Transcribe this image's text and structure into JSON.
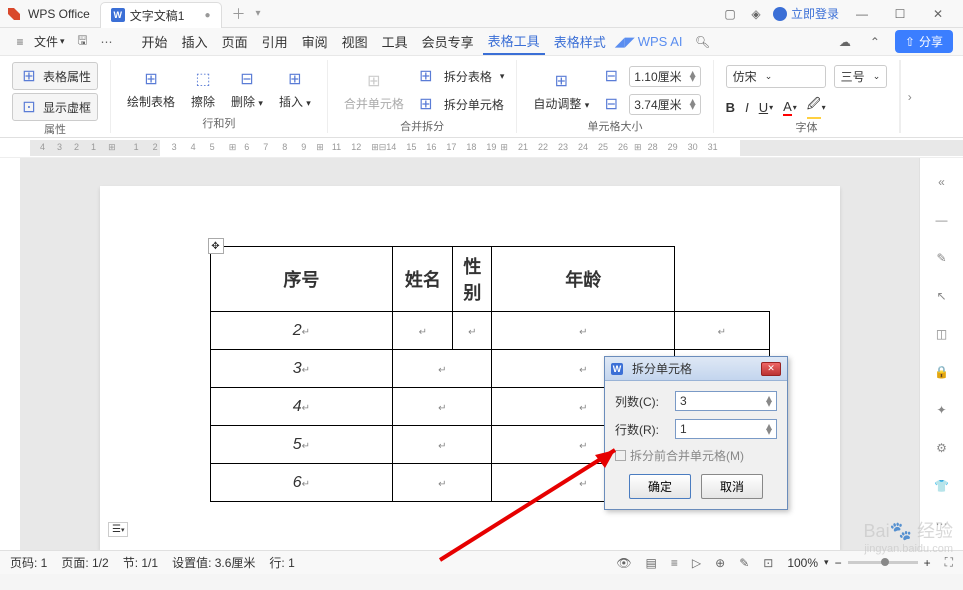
{
  "title_bar": {
    "app_name": "WPS Office",
    "tab_label": "文字文稿1",
    "login_text": "立即登录"
  },
  "menus": {
    "file": "文件",
    "items": [
      "开始",
      "插入",
      "页面",
      "引用",
      "审阅",
      "视图",
      "工具",
      "会员专享",
      "表格工具",
      "表格样式"
    ],
    "wps_ai": "WPS AI",
    "share": "分享"
  },
  "ribbon": {
    "group1": {
      "btn1": "表格属性",
      "btn2": "显示虚框",
      "label": "属性"
    },
    "group2": {
      "btn1": "绘制表格",
      "btn2": "擦除",
      "btn3": "删除",
      "btn4": "插入",
      "label": "行和列"
    },
    "group3": {
      "btn1": "合并单元格",
      "t1": "拆分表格",
      "t2": "拆分单元格",
      "label": "合并拆分"
    },
    "group4": {
      "btn1": "自动调整",
      "w": "1.10厘米",
      "h": "3.74厘米",
      "label": "单元格大小"
    },
    "group5": {
      "font": "仿宋",
      "size": "三号",
      "label": "字体"
    }
  },
  "table": {
    "headers": [
      "序号",
      "姓名",
      "性别",
      "年龄"
    ],
    "rows": [
      "2",
      "3",
      "4",
      "5",
      "6"
    ]
  },
  "dialog": {
    "title": "拆分单元格",
    "col_label": "列数(C):",
    "col_value": "3",
    "row_label": "行数(R):",
    "row_value": "1",
    "checkbox": "拆分前合并单元格(M)",
    "ok": "确定",
    "cancel": "取消"
  },
  "status": {
    "page_no": "页码: 1",
    "page_cnt": "页面: 1/2",
    "section": "节: 1/1",
    "setting": "设置值: 3.6厘米",
    "line": "行: 1",
    "zoom": "100%"
  },
  "watermark": {
    "brand": "经验"
  }
}
